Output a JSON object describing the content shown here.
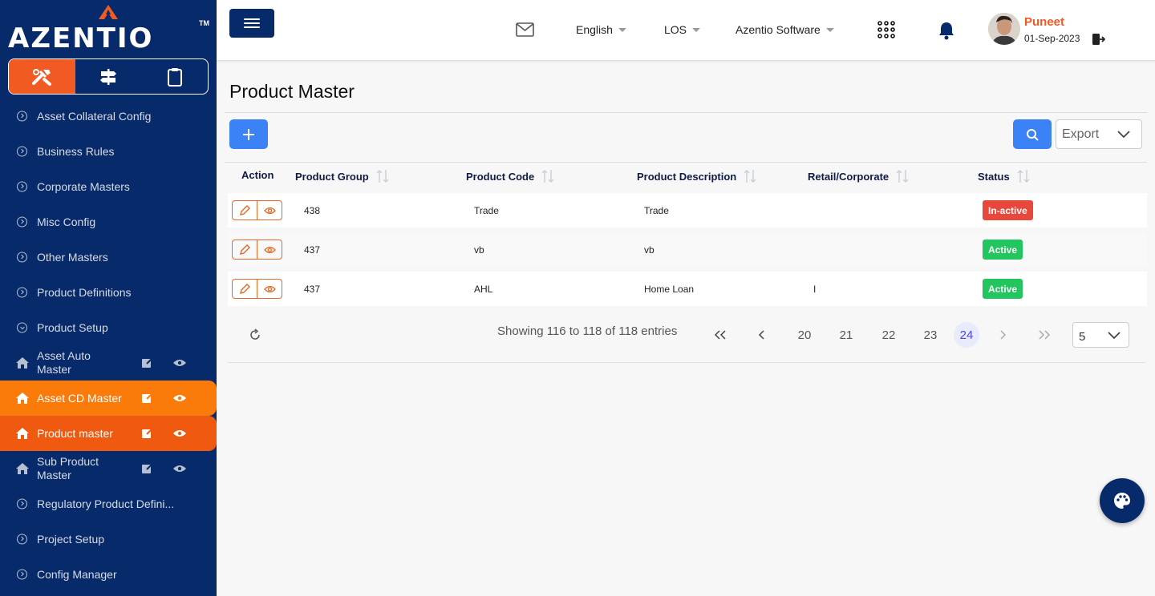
{
  "brand": {
    "logo_text": "AZENTIO",
    "tm": "TM"
  },
  "sidebar": {
    "tabs": [
      {
        "icon": "tools-icon",
        "active": true
      },
      {
        "icon": "signpost-icon",
        "active": false
      },
      {
        "icon": "clipboard-icon",
        "active": false
      }
    ],
    "items": [
      {
        "label": "Asset Collateral Config"
      },
      {
        "label": "Business Rules"
      },
      {
        "label": "Corporate Masters"
      },
      {
        "label": "Misc Config"
      },
      {
        "label": "Other Masters"
      },
      {
        "label": "Product Definitions"
      },
      {
        "label": "Product Setup"
      },
      {
        "label": "Asset Auto Master"
      },
      {
        "label": "Asset CD Master"
      },
      {
        "label": "Product master"
      },
      {
        "label": "Sub Product Master"
      },
      {
        "label": "Regulatory Product Defini..."
      },
      {
        "label": "Project Setup"
      },
      {
        "label": "Config Manager"
      }
    ],
    "highlight_colors": {
      "asset_cd": "#fa7a0a",
      "product_master": "#f05a10"
    }
  },
  "header": {
    "language": "English",
    "module": "LOS",
    "company": "Azentio Software",
    "user_name": "Puneet",
    "date": "01-Sep-2023"
  },
  "main": {
    "title": "Product Master",
    "export_label": "Export",
    "columns": [
      "Action",
      "Product Group",
      "Product Code",
      "Product Description",
      "Retail/Corporate",
      "Status"
    ],
    "rows": [
      {
        "group": "438",
        "code": "Trade",
        "description": "Trade",
        "retail": "",
        "status": "In-active"
      },
      {
        "group": "437",
        "code": "vb",
        "description": "vb",
        "retail": "",
        "status": "Active"
      },
      {
        "group": "437",
        "code": "AHL",
        "description": "Home Loan",
        "retail": "I",
        "status": "Active"
      }
    ],
    "pagination": {
      "summary": "Showing 116 to 118 of 118 entries",
      "pages": [
        "20",
        "21",
        "22",
        "23",
        "24"
      ],
      "current": "24",
      "per_page": "5"
    }
  },
  "colors": {
    "navy": "#072a6a",
    "orange": "#f15a22",
    "blue": "#3b82f6",
    "active": "#22c55e",
    "inactive": "#e8473c"
  }
}
